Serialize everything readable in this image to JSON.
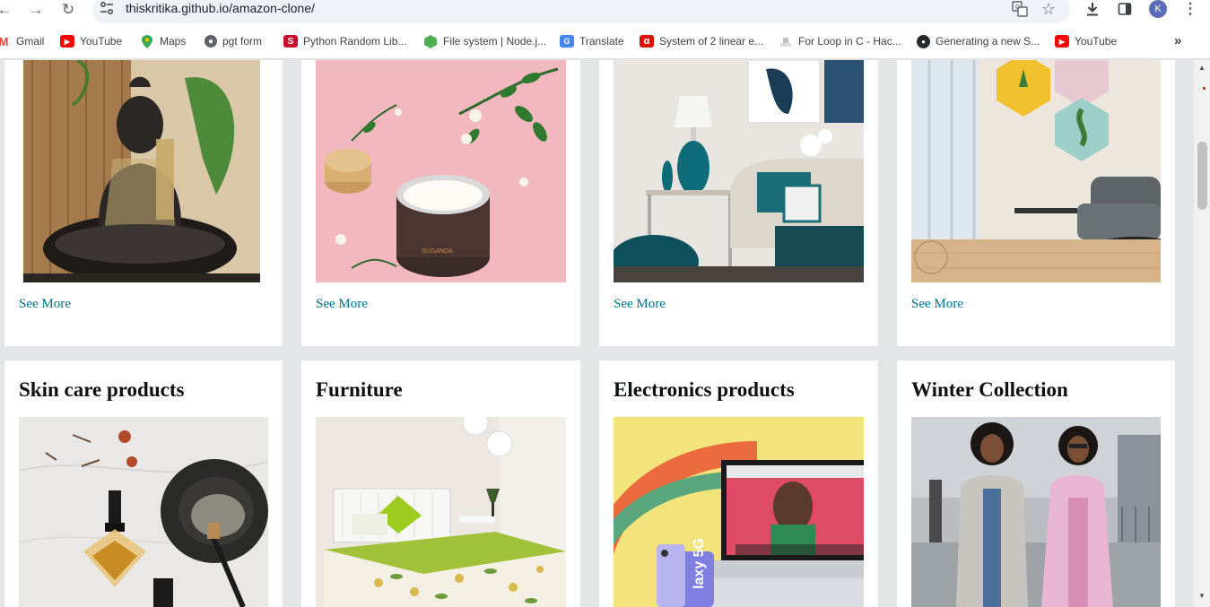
{
  "browser": {
    "url": "thiskritika.github.io/amazon-clone/",
    "profile_initial": "K",
    "bookmarks": [
      {
        "label": "Gmail",
        "icon": "gmail-icon",
        "color": "#ea4335"
      },
      {
        "label": "YouTube",
        "icon": "youtube-icon",
        "color": "#ff0000"
      },
      {
        "label": "Maps",
        "icon": "maps-icon",
        "color": "#34a853"
      },
      {
        "label": "pgt form",
        "icon": "globe-icon",
        "color": "#5f6368"
      },
      {
        "label": "Python Random Lib...",
        "icon": "s-logo-icon",
        "color": "#c8102e"
      },
      {
        "label": "File system | Node.j...",
        "icon": "nodejs-icon",
        "color": "#4caf50"
      },
      {
        "label": "Translate",
        "icon": "translate-icon",
        "color": "#4285f4"
      },
      {
        "label": "System of 2 linear e...",
        "icon": "wolfram-icon",
        "color": "#dd1100"
      },
      {
        "label": "For Loop in C - Hac...",
        "icon": "hackerrank-icon",
        "color": "#9aa0a6"
      },
      {
        "label": "Generating a new S...",
        "icon": "github-icon",
        "color": "#24292e"
      },
      {
        "label": "YouTube",
        "icon": "youtube-icon",
        "color": "#ff0000"
      }
    ]
  },
  "top_row": [
    {
      "image": "buddha-statue",
      "link": "See More"
    },
    {
      "image": "cream-jar",
      "link": "See More"
    },
    {
      "image": "living-room-decor",
      "link": "See More"
    },
    {
      "image": "hexagon-wall-planters",
      "link": "See More"
    }
  ],
  "bottom_row": [
    {
      "title": "Skin care products",
      "image": "skincare-oil-bottle"
    },
    {
      "title": "Furniture",
      "image": "bed-with-floral-sheet"
    },
    {
      "title": "Electronics products",
      "image": "laptop-and-phone"
    },
    {
      "title": "Winter Collection",
      "image": "two-women-in-coats"
    }
  ],
  "colors": {
    "page_bg": "#e3e6e6",
    "link": "#007185",
    "title": "#0f1111"
  }
}
